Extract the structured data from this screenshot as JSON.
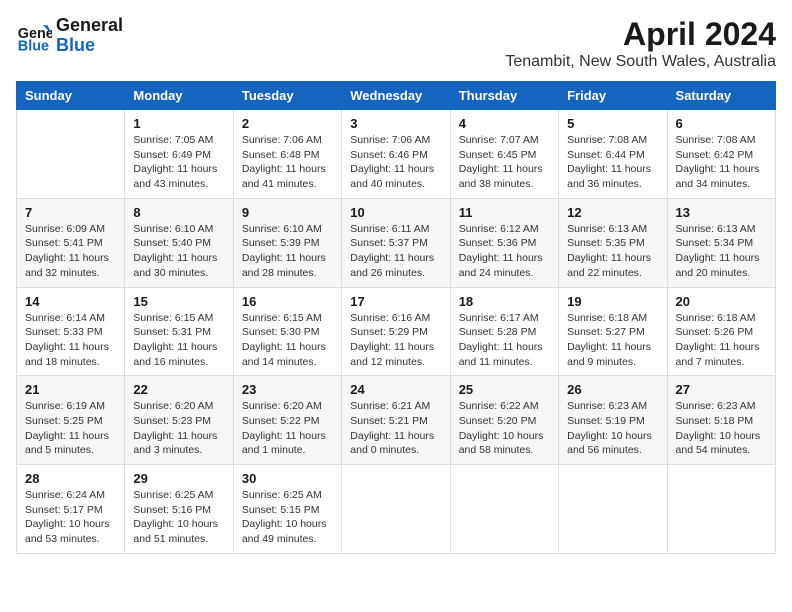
{
  "header": {
    "logo_line1": "General",
    "logo_line2": "Blue",
    "month": "April 2024",
    "location": "Tenambit, New South Wales, Australia"
  },
  "weekdays": [
    "Sunday",
    "Monday",
    "Tuesday",
    "Wednesday",
    "Thursday",
    "Friday",
    "Saturday"
  ],
  "weeks": [
    [
      {
        "day": "",
        "info": ""
      },
      {
        "day": "1",
        "info": "Sunrise: 7:05 AM\nSunset: 6:49 PM\nDaylight: 11 hours\nand 43 minutes."
      },
      {
        "day": "2",
        "info": "Sunrise: 7:06 AM\nSunset: 6:48 PM\nDaylight: 11 hours\nand 41 minutes."
      },
      {
        "day": "3",
        "info": "Sunrise: 7:06 AM\nSunset: 6:46 PM\nDaylight: 11 hours\nand 40 minutes."
      },
      {
        "day": "4",
        "info": "Sunrise: 7:07 AM\nSunset: 6:45 PM\nDaylight: 11 hours\nand 38 minutes."
      },
      {
        "day": "5",
        "info": "Sunrise: 7:08 AM\nSunset: 6:44 PM\nDaylight: 11 hours\nand 36 minutes."
      },
      {
        "day": "6",
        "info": "Sunrise: 7:08 AM\nSunset: 6:42 PM\nDaylight: 11 hours\nand 34 minutes."
      }
    ],
    [
      {
        "day": "7",
        "info": "Sunrise: 6:09 AM\nSunset: 5:41 PM\nDaylight: 11 hours\nand 32 minutes."
      },
      {
        "day": "8",
        "info": "Sunrise: 6:10 AM\nSunset: 5:40 PM\nDaylight: 11 hours\nand 30 minutes."
      },
      {
        "day": "9",
        "info": "Sunrise: 6:10 AM\nSunset: 5:39 PM\nDaylight: 11 hours\nand 28 minutes."
      },
      {
        "day": "10",
        "info": "Sunrise: 6:11 AM\nSunset: 5:37 PM\nDaylight: 11 hours\nand 26 minutes."
      },
      {
        "day": "11",
        "info": "Sunrise: 6:12 AM\nSunset: 5:36 PM\nDaylight: 11 hours\nand 24 minutes."
      },
      {
        "day": "12",
        "info": "Sunrise: 6:13 AM\nSunset: 5:35 PM\nDaylight: 11 hours\nand 22 minutes."
      },
      {
        "day": "13",
        "info": "Sunrise: 6:13 AM\nSunset: 5:34 PM\nDaylight: 11 hours\nand 20 minutes."
      }
    ],
    [
      {
        "day": "14",
        "info": "Sunrise: 6:14 AM\nSunset: 5:33 PM\nDaylight: 11 hours\nand 18 minutes."
      },
      {
        "day": "15",
        "info": "Sunrise: 6:15 AM\nSunset: 5:31 PM\nDaylight: 11 hours\nand 16 minutes."
      },
      {
        "day": "16",
        "info": "Sunrise: 6:15 AM\nSunset: 5:30 PM\nDaylight: 11 hours\nand 14 minutes."
      },
      {
        "day": "17",
        "info": "Sunrise: 6:16 AM\nSunset: 5:29 PM\nDaylight: 11 hours\nand 12 minutes."
      },
      {
        "day": "18",
        "info": "Sunrise: 6:17 AM\nSunset: 5:28 PM\nDaylight: 11 hours\nand 11 minutes."
      },
      {
        "day": "19",
        "info": "Sunrise: 6:18 AM\nSunset: 5:27 PM\nDaylight: 11 hours\nand 9 minutes."
      },
      {
        "day": "20",
        "info": "Sunrise: 6:18 AM\nSunset: 5:26 PM\nDaylight: 11 hours\nand 7 minutes."
      }
    ],
    [
      {
        "day": "21",
        "info": "Sunrise: 6:19 AM\nSunset: 5:25 PM\nDaylight: 11 hours\nand 5 minutes."
      },
      {
        "day": "22",
        "info": "Sunrise: 6:20 AM\nSunset: 5:23 PM\nDaylight: 11 hours\nand 3 minutes."
      },
      {
        "day": "23",
        "info": "Sunrise: 6:20 AM\nSunset: 5:22 PM\nDaylight: 11 hours\nand 1 minute."
      },
      {
        "day": "24",
        "info": "Sunrise: 6:21 AM\nSunset: 5:21 PM\nDaylight: 11 hours\nand 0 minutes."
      },
      {
        "day": "25",
        "info": "Sunrise: 6:22 AM\nSunset: 5:20 PM\nDaylight: 10 hours\nand 58 minutes."
      },
      {
        "day": "26",
        "info": "Sunrise: 6:23 AM\nSunset: 5:19 PM\nDaylight: 10 hours\nand 56 minutes."
      },
      {
        "day": "27",
        "info": "Sunrise: 6:23 AM\nSunset: 5:18 PM\nDaylight: 10 hours\nand 54 minutes."
      }
    ],
    [
      {
        "day": "28",
        "info": "Sunrise: 6:24 AM\nSunset: 5:17 PM\nDaylight: 10 hours\nand 53 minutes."
      },
      {
        "day": "29",
        "info": "Sunrise: 6:25 AM\nSunset: 5:16 PM\nDaylight: 10 hours\nand 51 minutes."
      },
      {
        "day": "30",
        "info": "Sunrise: 6:25 AM\nSunset: 5:15 PM\nDaylight: 10 hours\nand 49 minutes."
      },
      {
        "day": "",
        "info": ""
      },
      {
        "day": "",
        "info": ""
      },
      {
        "day": "",
        "info": ""
      },
      {
        "day": "",
        "info": ""
      }
    ]
  ]
}
